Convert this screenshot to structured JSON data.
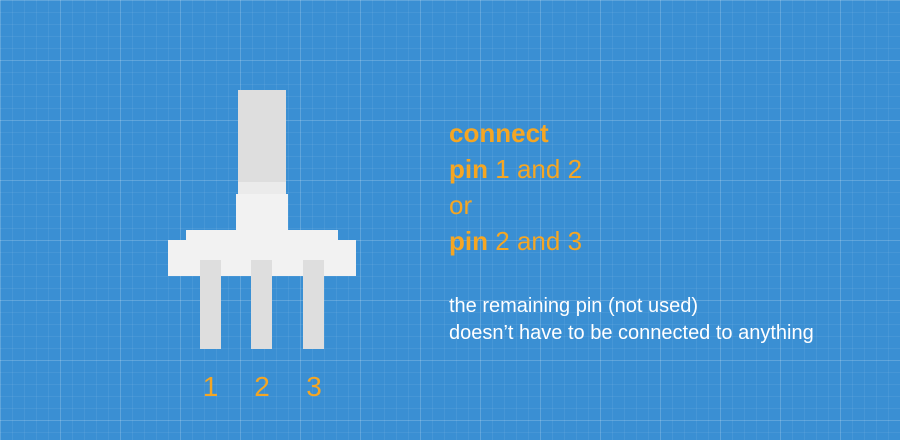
{
  "colors": {
    "background": "#3a8fd3",
    "component_light": "#f2f2f2",
    "component_shade": "#dedede",
    "accent": "#f5a623",
    "note_text": "#ffffff"
  },
  "pins": [
    {
      "label": "1"
    },
    {
      "label": "2"
    },
    {
      "label": "3"
    }
  ],
  "instructions": {
    "heading": "connect",
    "option1": {
      "pin_word": "pin",
      "first": "1",
      "joiner": "and",
      "second": "2"
    },
    "or": "or",
    "option2": {
      "pin_word": "pin",
      "first": "2",
      "joiner": "and",
      "second": "3"
    }
  },
  "note": {
    "line1": "the remaining pin (not used)",
    "line2": "doesn’t have to be connected to anything"
  }
}
